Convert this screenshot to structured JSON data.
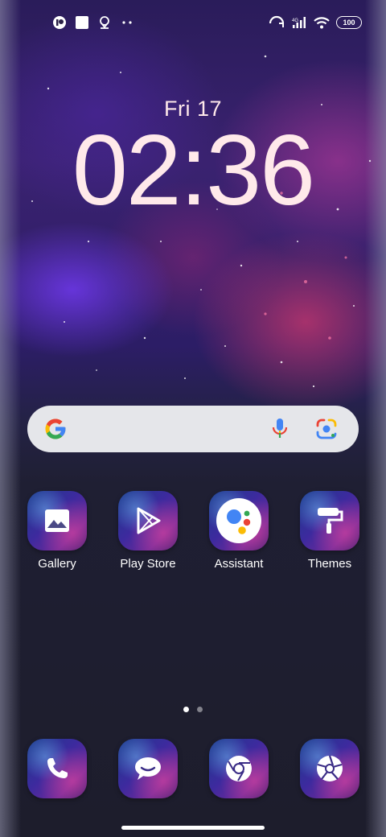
{
  "status_bar": {
    "left_icons": [
      "app-notification-icon",
      "square-notification-icon",
      "location-badge-icon",
      "more-notifications-icon"
    ],
    "right_icons": [
      "hotspot-icon",
      "cellular-signal-icon",
      "wifi-icon",
      "battery-icon"
    ],
    "battery_level": "100"
  },
  "clock": {
    "date": "Fri 17",
    "time": "02:36"
  },
  "search_bar": {
    "icons": [
      "google-g-icon",
      "microphone-icon",
      "google-lens-icon"
    ]
  },
  "apps": [
    {
      "label": "Gallery",
      "icon": "gallery-icon"
    },
    {
      "label": "Play Store",
      "icon": "play-store-icon"
    },
    {
      "label": "Assistant",
      "icon": "assistant-icon"
    },
    {
      "label": "Themes",
      "icon": "paint-roller-icon"
    }
  ],
  "page_indicator": {
    "page_count": 2,
    "current_page": 1
  },
  "dock": [
    {
      "icon": "phone-icon"
    },
    {
      "icon": "messages-icon"
    },
    {
      "icon": "chrome-icon"
    },
    {
      "icon": "camera-icon"
    }
  ],
  "colors": {
    "clock_text": "#ffe9ea",
    "search_bar_bg": "#e5e6ea",
    "google_blue": "#4285F4",
    "google_red": "#EA4335",
    "google_yellow": "#FBBC05",
    "google_green": "#34A853"
  }
}
